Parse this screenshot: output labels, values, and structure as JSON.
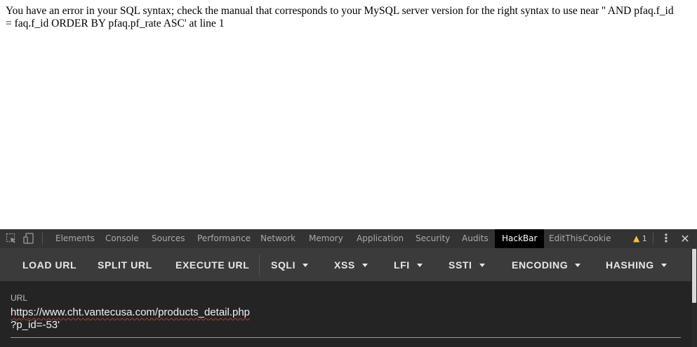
{
  "page": {
    "error_message": "You have an error in your SQL syntax; check the manual that corresponds to your MySQL server version for the right syntax to use near '' AND pfaq.f_id = faq.f_id ORDER BY pfaq.pf_rate ASC' at line 1"
  },
  "devtools": {
    "tabs": [
      {
        "label": "Elements"
      },
      {
        "label": "Console"
      },
      {
        "label": "Sources"
      },
      {
        "label": "Performance"
      },
      {
        "label": "Network"
      },
      {
        "label": "Memory"
      },
      {
        "label": "Application"
      },
      {
        "label": "Security"
      },
      {
        "label": "Audits"
      },
      {
        "label": "HackBar"
      },
      {
        "label": "EditThisCookie"
      }
    ],
    "active_tab": "HackBar",
    "warning_count": "1",
    "icons": {
      "inspect": "inspect-element-icon",
      "device": "device-toolbar-icon",
      "warning": "warning-icon",
      "menu": "more-vertical-icon",
      "close": "close-icon"
    }
  },
  "hackbar": {
    "buttons": [
      {
        "label": "LOAD URL"
      },
      {
        "label": "SPLIT URL"
      },
      {
        "label": "EXECUTE URL"
      },
      {
        "label": "SQLI"
      },
      {
        "label": "XSS"
      },
      {
        "label": "LFI"
      },
      {
        "label": "SSTI"
      },
      {
        "label": "ENCODING"
      },
      {
        "label": "HASHING"
      }
    ],
    "url_label": "URL",
    "url_line1": "https://www.cht.vantecusa.com/products_detail.php",
    "url_line2": "?p_id=-53'"
  },
  "colors": {
    "devtools_bg": "#242424",
    "tabbar_bg": "#333333",
    "toolbar_bg": "#3b3b3b",
    "active_tab_bg": "#000000",
    "warning": "#f4c142",
    "spellcheck": "#c0392b"
  }
}
